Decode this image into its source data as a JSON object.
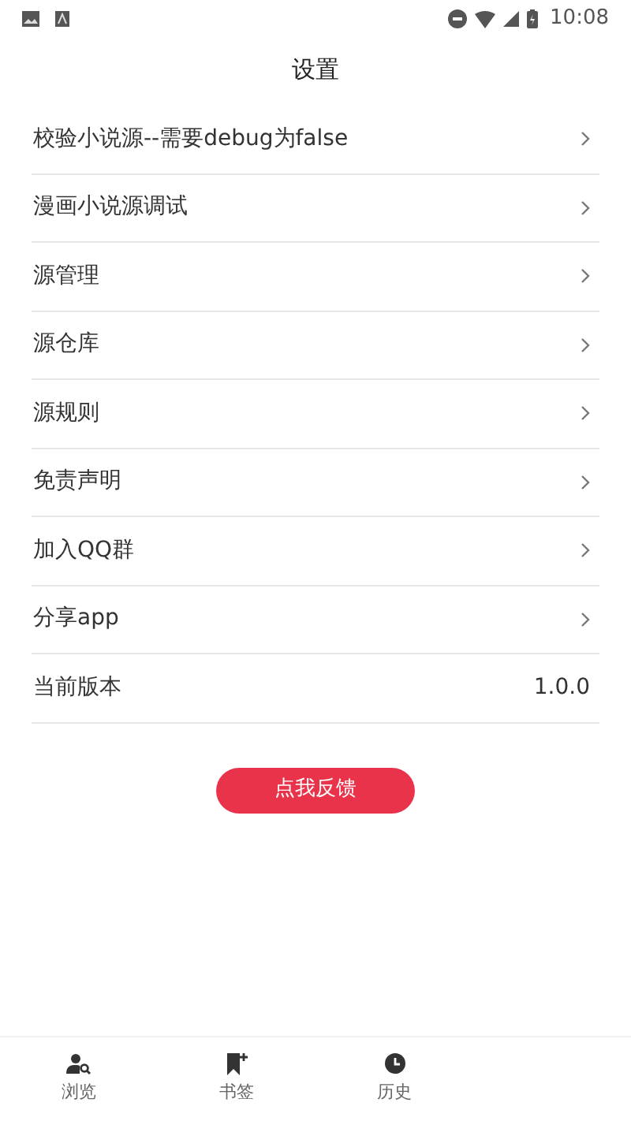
{
  "status_bar": {
    "time": "10:08"
  },
  "header": {
    "title": "设置"
  },
  "settings": [
    {
      "label": "校验小说源--需要debug为false",
      "kind": "link"
    },
    {
      "label": "漫画小说源调试",
      "kind": "link"
    },
    {
      "label": "源管理",
      "kind": "link"
    },
    {
      "label": "源仓库",
      "kind": "link"
    },
    {
      "label": "源规则",
      "kind": "link"
    },
    {
      "label": "免责声明",
      "kind": "link"
    },
    {
      "label": "加入QQ群",
      "kind": "link"
    },
    {
      "label": "分享app",
      "kind": "link"
    },
    {
      "label": "当前版本",
      "kind": "value",
      "value": "1.0.0"
    }
  ],
  "feedback_button": "点我反馈",
  "bottom_nav": [
    {
      "label": "浏览",
      "kind": "browse"
    },
    {
      "label": "书签",
      "kind": "bookmark"
    },
    {
      "label": "历史",
      "kind": "history"
    }
  ]
}
